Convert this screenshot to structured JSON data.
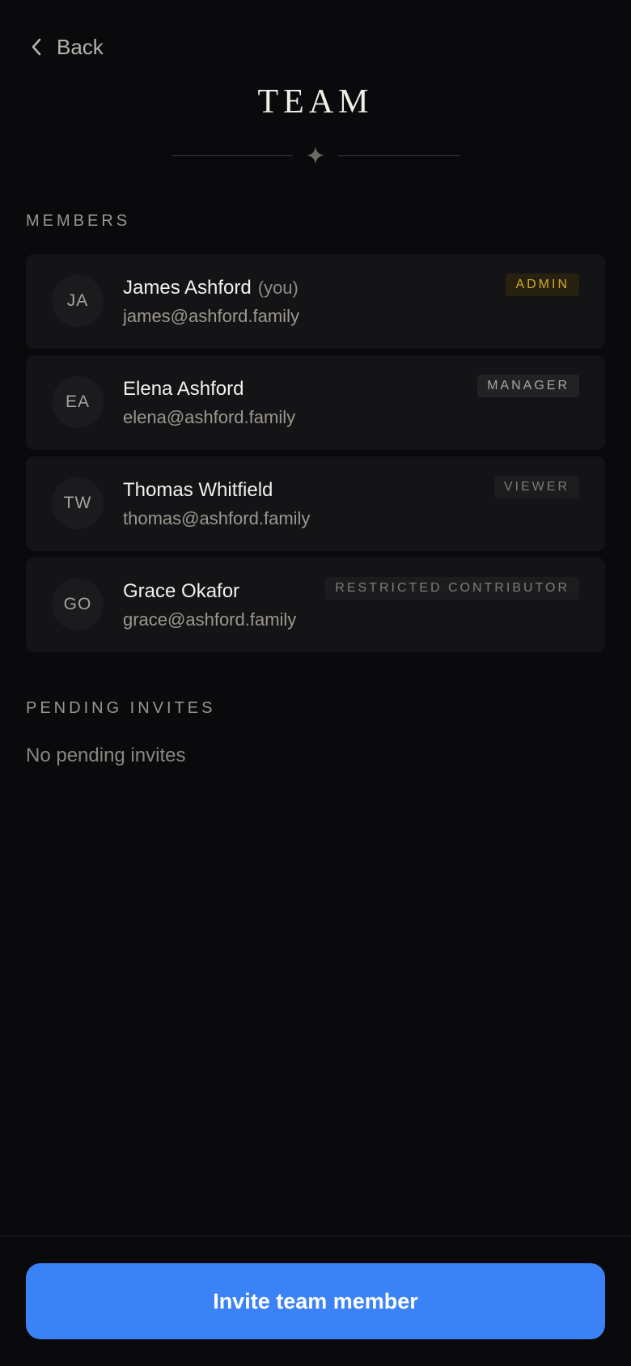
{
  "nav": {
    "back_label": "Back",
    "back_icon": "chevron-left-icon"
  },
  "header": {
    "title": "TEAM",
    "ornament_icon": "sparkle-icon"
  },
  "members": {
    "section_label": "MEMBERS",
    "items": [
      {
        "initials": "JA",
        "name": "James Ashford",
        "you_label": "(you)",
        "email": "james@ashford.family",
        "role": "ADMIN"
      },
      {
        "initials": "EA",
        "name": "Elena Ashford",
        "email": "elena@ashford.family",
        "role": "MANAGER"
      },
      {
        "initials": "TW",
        "name": "Thomas Whitfield",
        "email": "thomas@ashford.family",
        "role": "VIEWER"
      },
      {
        "initials": "GO",
        "name": "Grace Okafor",
        "email": "grace@ashford.family",
        "role": "RESTRICTED CONTRIBUTOR"
      }
    ]
  },
  "pending": {
    "section_label": "PENDING INVITES",
    "empty_text": "No pending invites"
  },
  "footer": {
    "invite_label": "Invite team member"
  },
  "colors": {
    "background": "#0a0a0c",
    "card": "#141416",
    "accent": "#3b82f6",
    "admin_badge": "#d3a82e"
  }
}
